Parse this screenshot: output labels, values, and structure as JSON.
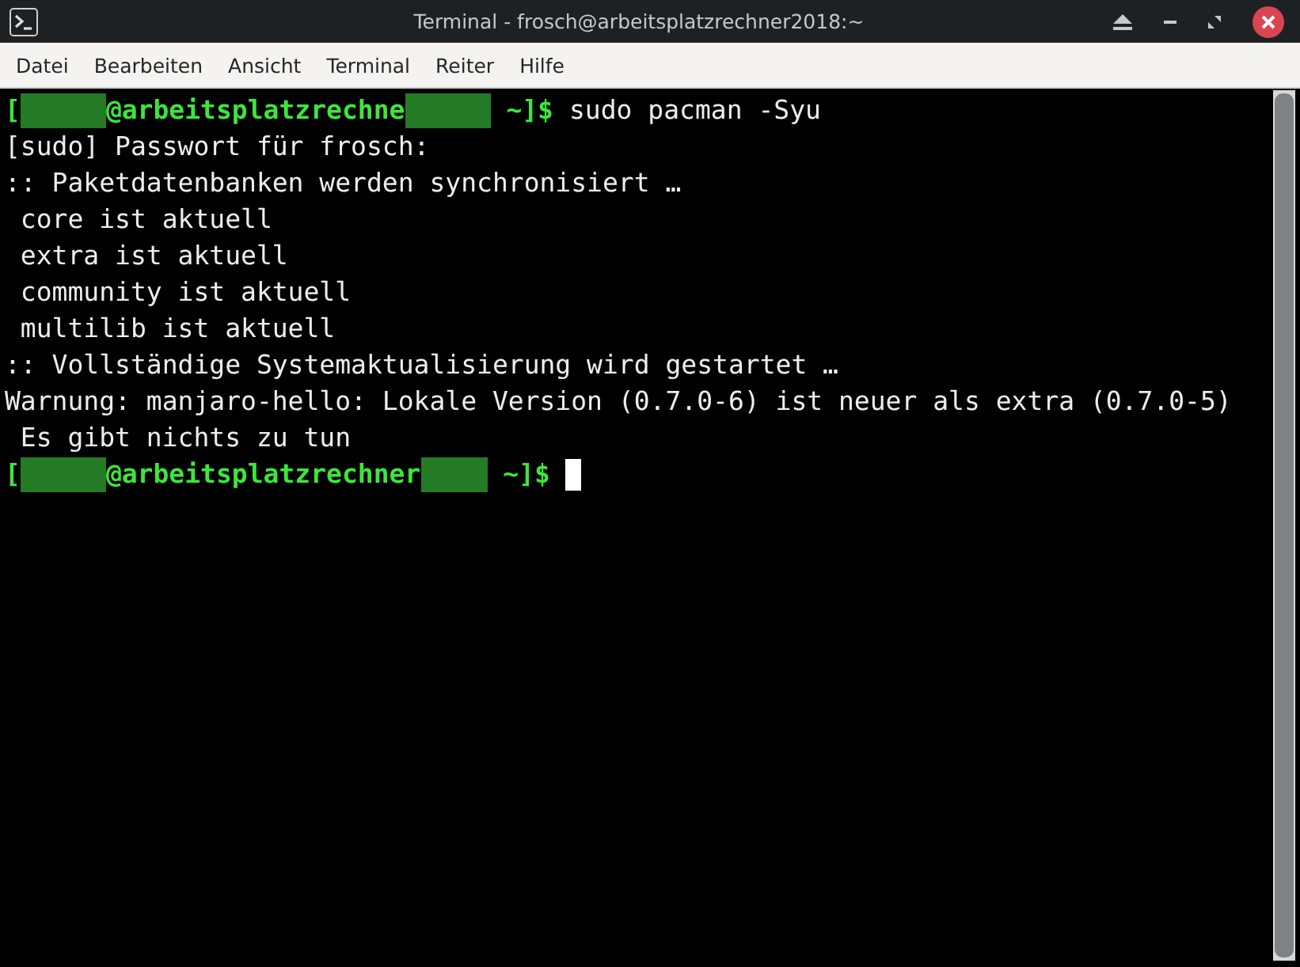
{
  "window": {
    "title": "Terminal - frosch@arbeitsplatzrechner2018:~"
  },
  "menu": [
    "Datei",
    "Bearbeiten",
    "Ansicht",
    "Terminal",
    "Reiter",
    "Hilfe"
  ],
  "terminal": {
    "lines": [
      {
        "kind": "prompt",
        "open": "[",
        "host": "@arbeitsplatzrechne",
        "close": "~]$",
        "command": "sudo pacman -Syu",
        "cursor": false
      },
      {
        "kind": "output",
        "text": "[sudo] Passwort für frosch:"
      },
      {
        "kind": "output",
        "text": ":: Paketdatenbanken werden synchronisiert …"
      },
      {
        "kind": "output",
        "text": " core ist aktuell"
      },
      {
        "kind": "output",
        "text": " extra ist aktuell"
      },
      {
        "kind": "output",
        "text": " community ist aktuell"
      },
      {
        "kind": "output",
        "text": " multilib ist aktuell"
      },
      {
        "kind": "output",
        "text": ":: Vollständige Systemaktualisierung wird gestartet …"
      },
      {
        "kind": "output",
        "text": "Warnung: manjaro-hello: Lokale Version (0.7.0-6) ist neuer als extra (0.7.0-5)"
      },
      {
        "kind": "output",
        "text": " Es gibt nichts zu tun"
      },
      {
        "kind": "prompt",
        "open": "[",
        "host": "@arbeitsplatzrechner",
        "close": "~]$",
        "cursor": true
      }
    ]
  }
}
